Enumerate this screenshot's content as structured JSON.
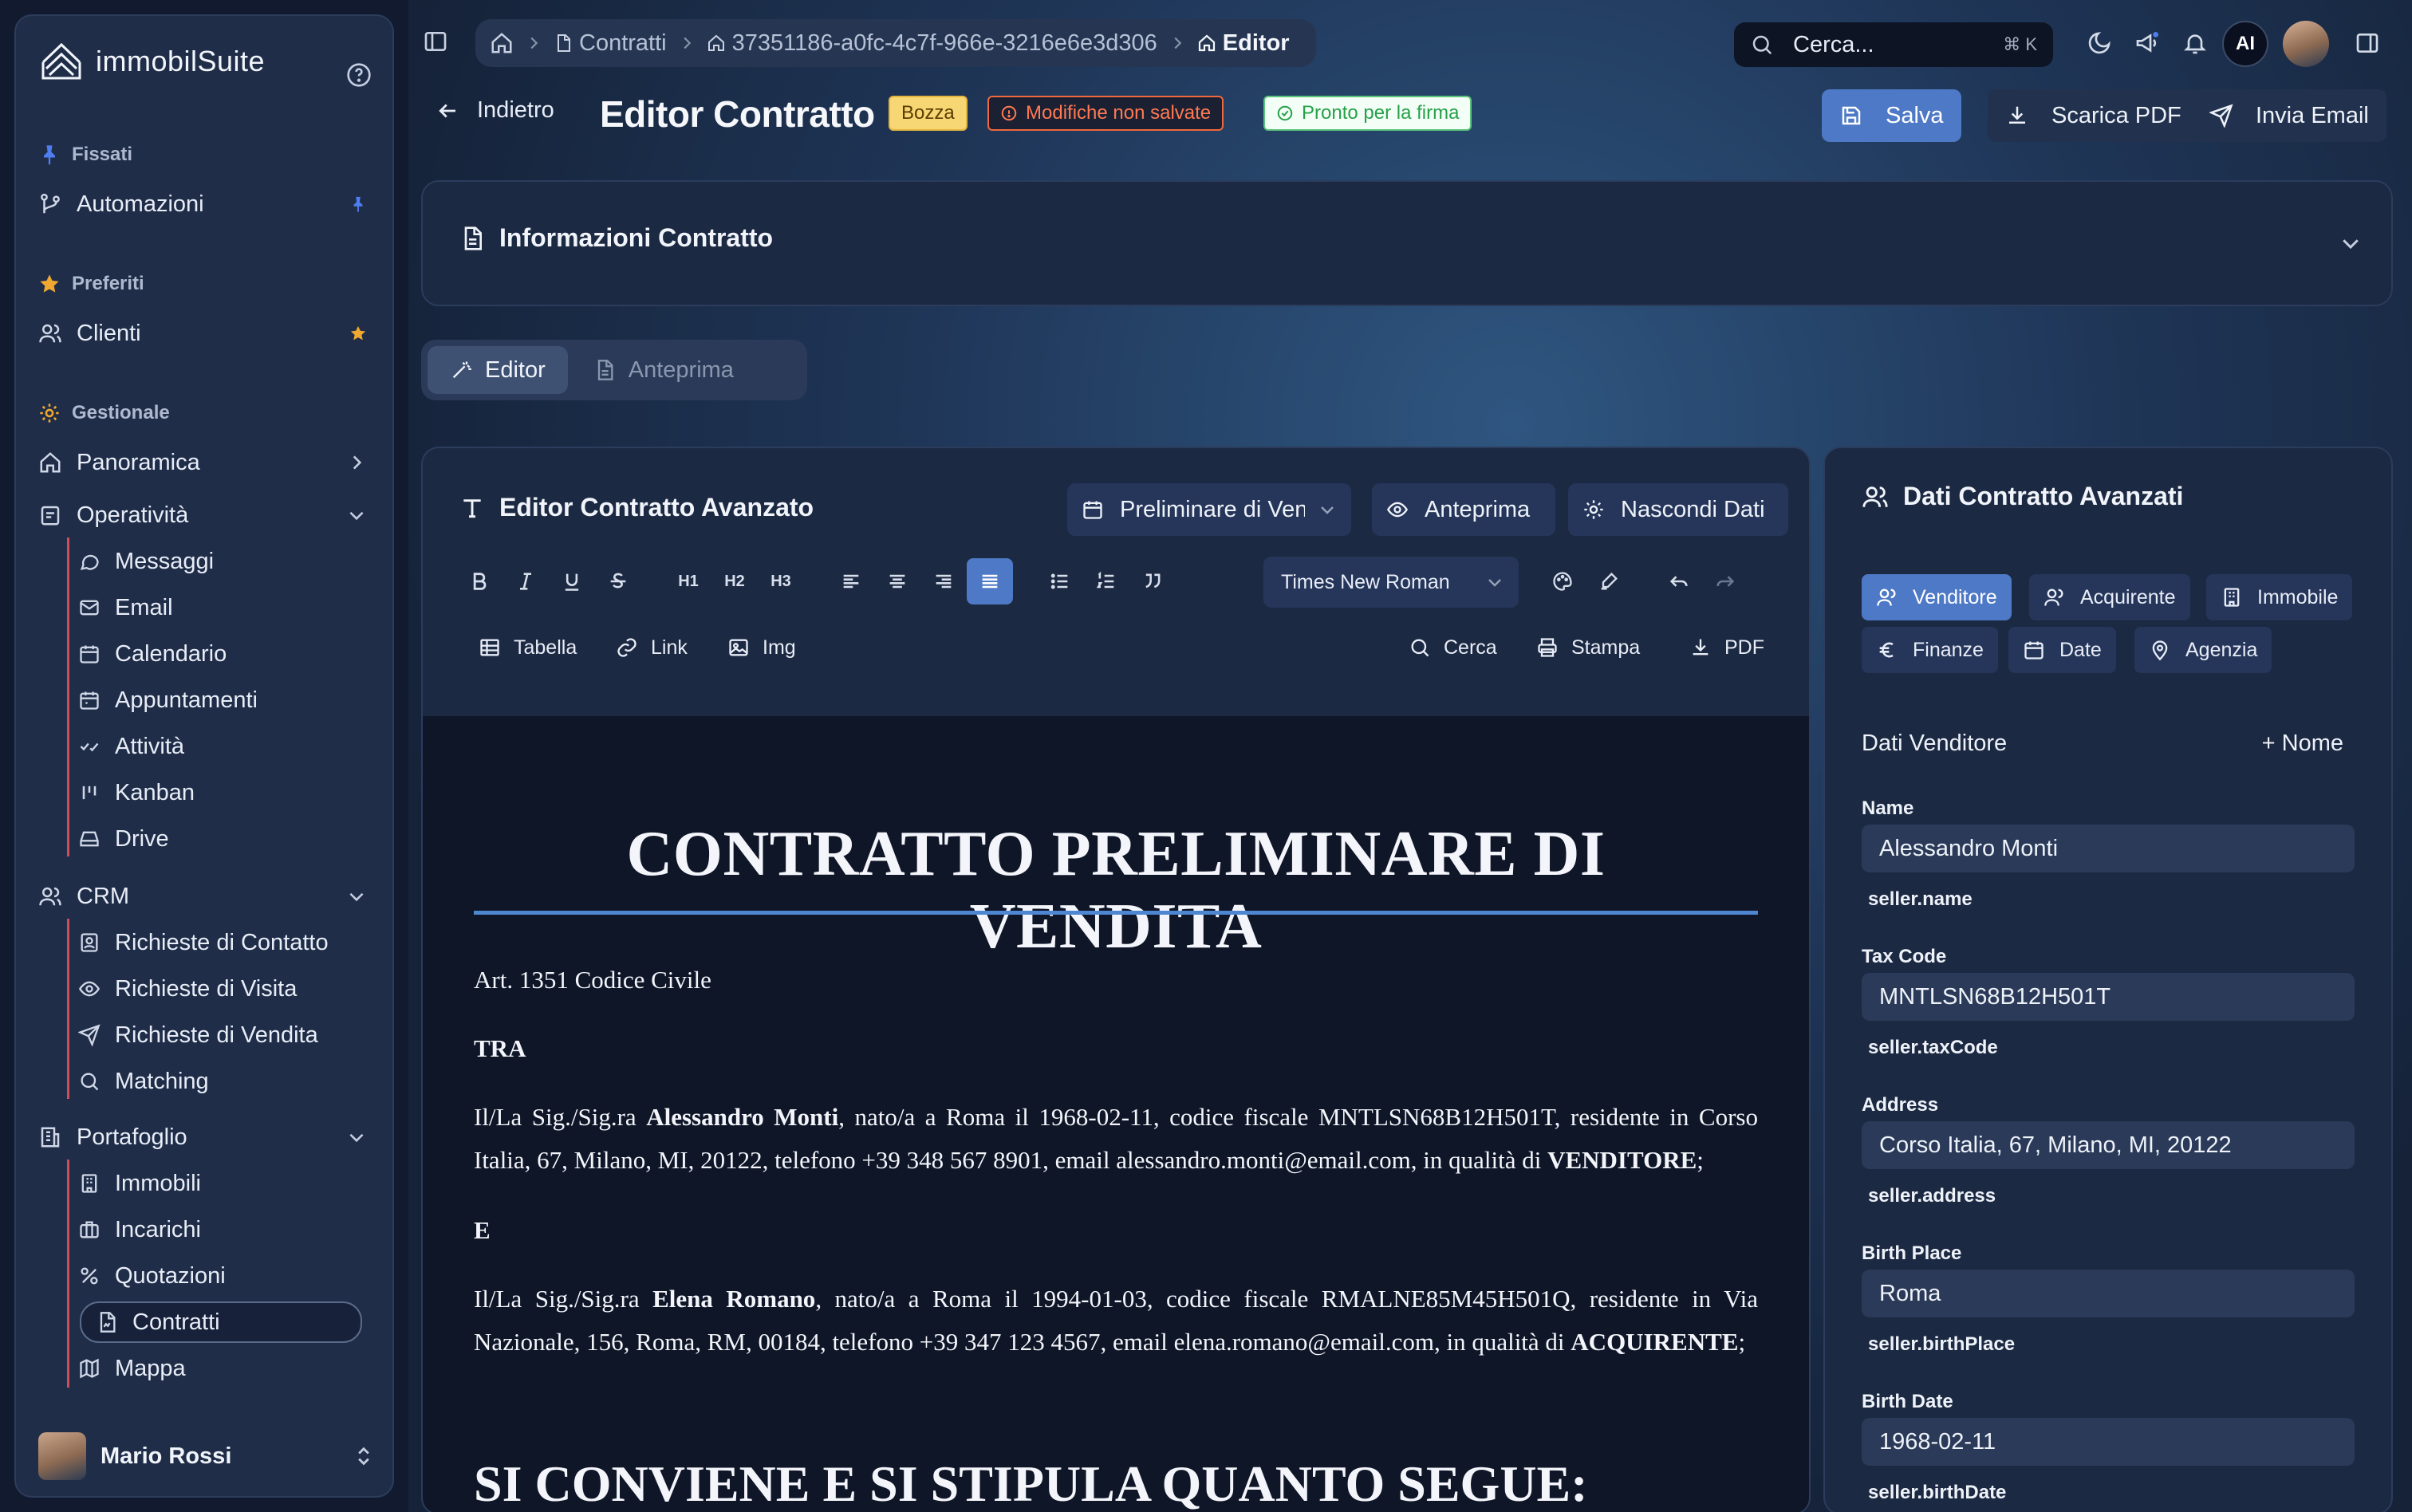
{
  "sidebar": {
    "brand": "immobilSuite",
    "sections": {
      "pinned": "Fissati",
      "favorites": "Preferiti",
      "management": "Gestionale"
    },
    "pinned_items": [
      {
        "label": "Automazioni"
      }
    ],
    "favorite_items": [
      {
        "label": "Clienti"
      }
    ],
    "items": {
      "overview": "Panoramica",
      "operations": "Operatività",
      "messages": "Messaggi",
      "email": "Email",
      "calendar": "Calendario",
      "appointments": "Appuntamenti",
      "activities": "Attività",
      "kanban": "Kanban",
      "drive": "Drive",
      "crm": "CRM",
      "contact_requests": "Richieste di Contatto",
      "visit_requests": "Richieste di Visita",
      "sale_requests": "Richieste di Vendita",
      "matching": "Matching",
      "portfolio": "Portafoglio",
      "properties": "Immobili",
      "assignments": "Incarichi",
      "quotations": "Quotazioni",
      "contracts": "Contratti",
      "map": "Mappa"
    },
    "user": {
      "name": "Mario Rossi"
    }
  },
  "topbar": {
    "breadcrumb": {
      "contracts": "Contratti",
      "contract_id": "37351186-a0fc-4c7f-966e-3216e6e3d306",
      "current": "Editor"
    },
    "search": {
      "placeholder": "Cerca...",
      "shortcut": "⌘ K"
    },
    "ai_label": "AI"
  },
  "page": {
    "back": "Indietro",
    "title": "Editor Contratto",
    "badges": {
      "draft": "Bozza",
      "unsaved": "Modifiche non salvate",
      "ready": "Pronto per la firma"
    },
    "actions": {
      "save": "Salva",
      "download_pdf": "Scarica PDF",
      "send_email": "Invia Email"
    }
  },
  "info_panel": {
    "title": "Informazioni Contratto"
  },
  "mode_tabs": {
    "editor": "Editor",
    "preview": "Anteprima"
  },
  "editor": {
    "title": "Editor Contratto Avanzato",
    "template_select": "Preliminare di Vendita",
    "preview_btn": "Anteprima",
    "hide_data_btn": "Nascondi Dati",
    "toolbar": {
      "h1": "H1",
      "h2": "H2",
      "h3": "H3",
      "font": "Times New Roman",
      "table": "Tabella",
      "link": "Link",
      "img": "Img",
      "find": "Cerca",
      "print": "Stampa",
      "pdf": "PDF"
    }
  },
  "document": {
    "title": "CONTRATTO PRELIMINARE DI VENDITA",
    "law_ref": "Art. 1351 Codice Civile",
    "between": "TRA",
    "seller_prefix": "Il/La Sig./Sig.ra ",
    "seller_name": "Alessandro Monti",
    "seller_rest": ", nato/a a Roma il 1968-02-11, codice fiscale MNTLSN68B12H501T, residente in Corso Italia, 67, Milano, MI, 20122, telefono +39 348 567 8901, email alessandro.monti@email.com, in qualità di ",
    "seller_role": "VENDITORE",
    "and": "E",
    "buyer_prefix": "Il/La Sig./Sig.ra ",
    "buyer_name": "Elena Romano",
    "buyer_rest": ", nato/a a Roma il 1994-01-03, codice fiscale RMALNE85M45H501Q, residente in Via Nazionale, 156, Roma, RM, 00184, telefono +39 347 123 4567, email elena.romano@email.com, in qualità di ",
    "buyer_role": "ACQUIRENTE",
    "clause_heading": "SI CONVIENE E SI STIPULA QUANTO SEGUE:"
  },
  "data_panel": {
    "title": "Dati Contratto Avanzati",
    "tabs": {
      "seller": "Venditore",
      "buyer": "Acquirente",
      "property": "Immobile",
      "finance": "Finanze",
      "dates": "Date",
      "agency": "Agenzia"
    },
    "section_title": "Dati Venditore",
    "add_name": "+ Nome",
    "fields": [
      {
        "label": "Name",
        "value": "Alessandro Monti",
        "key": "seller.name"
      },
      {
        "label": "Tax Code",
        "value": "MNTLSN68B12H501T",
        "key": "seller.taxCode"
      },
      {
        "label": "Address",
        "value": "Corso Italia, 67, Milano, MI, 20122",
        "key": "seller.address"
      },
      {
        "label": "Birth Place",
        "value": "Roma",
        "key": "seller.birthPlace"
      },
      {
        "label": "Birth Date",
        "value": "1968-02-11",
        "key": "seller.birthDate"
      }
    ]
  },
  "colors": {
    "accent": "#4e79c6",
    "draft_badge": "#f7d774",
    "unsaved_badge": "#f0683e",
    "ready_badge": "#5bc47b",
    "favorite_star": "#f0a830",
    "pin": "#4f7ef0"
  }
}
